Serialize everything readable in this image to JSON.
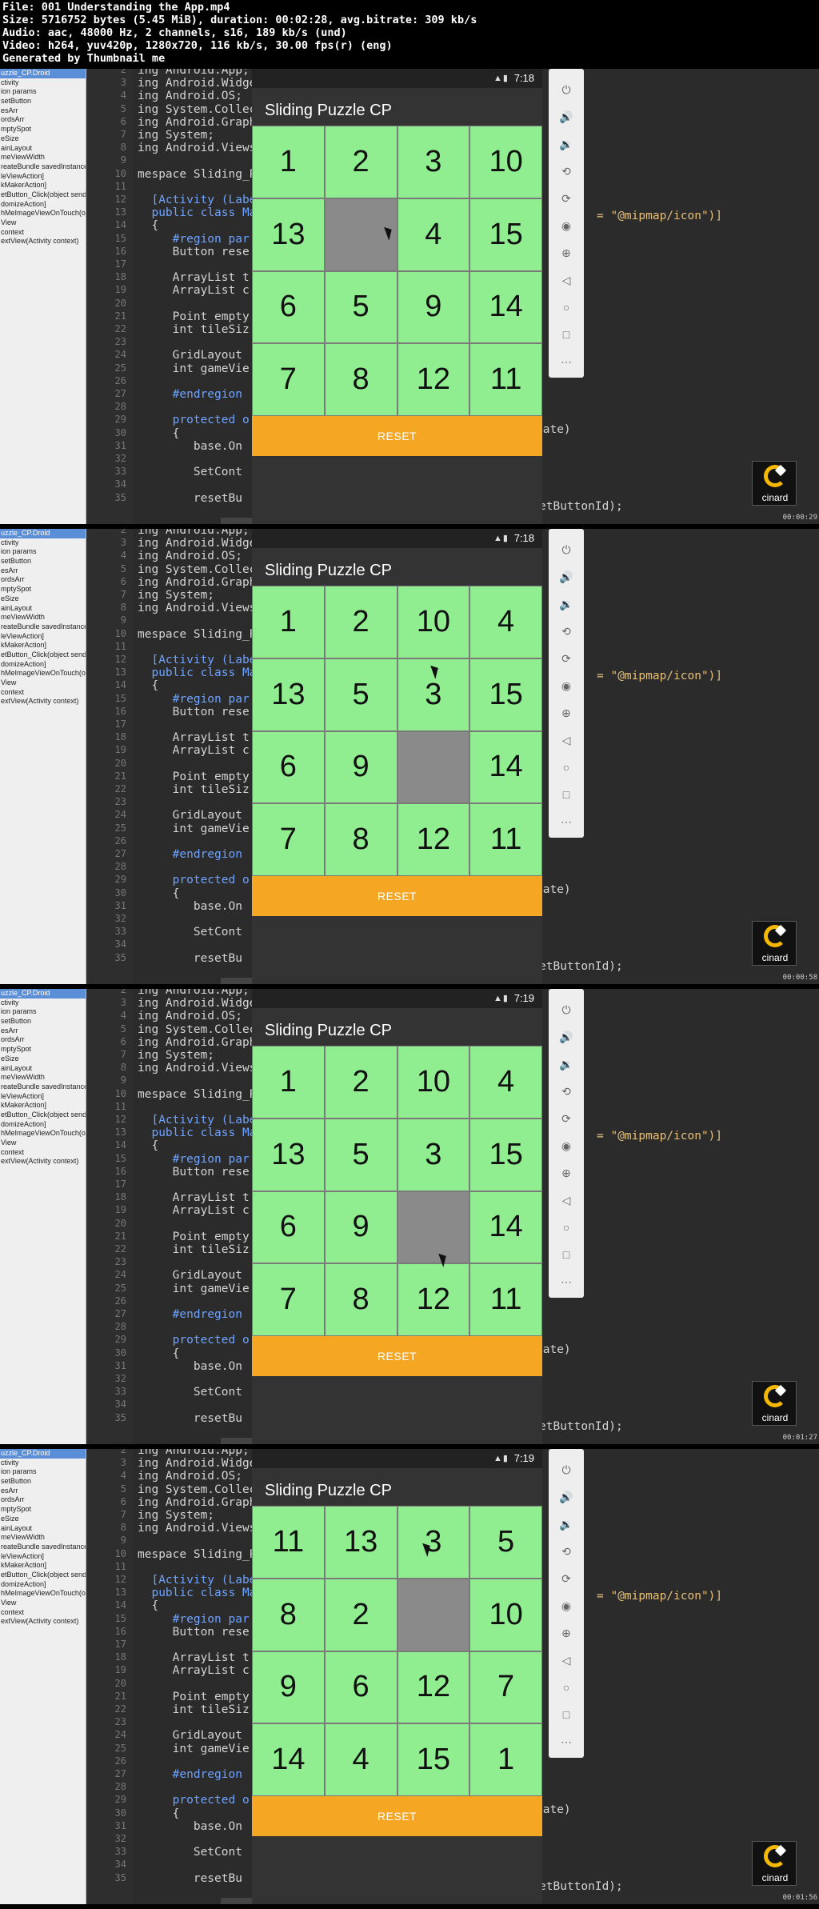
{
  "header": {
    "lines": [
      "File: 001 Understanding the App.mp4",
      "Size: 5716752 bytes (5.45 MiB), duration: 00:02:28, avg.bitrate: 309 kb/s",
      "Audio: aac, 48000 Hz, 2 channels, s16, 189 kb/s (und)",
      "Video: h264, yuv420p, 1280x720, 116 kb/s, 30.00 fps(r) (eng)",
      "Generated by Thumbnail me"
    ]
  },
  "sidebar_items": [
    "uzzle_CP.Droid",
    "ctivity",
    "ion params",
    "setButton",
    "esArr",
    "ordsArr",
    "mptySpot",
    "eSize",
    "ainLayout",
    "meViewWidth",
    "reateBundle savedInstance",
    "leViewAction]",
    "kMakerAction]",
    "etButton_Click(object sender",
    "domizeAction]",
    "hMeImageViewOnTouch(ob",
    "View",
    "context",
    "extView(Activity context)"
  ],
  "code_lines": [
    {
      "n": "2",
      "t": "ing Android.App;"
    },
    {
      "n": "3",
      "t": "ing Android.Widge"
    },
    {
      "n": "4",
      "t": "ing Android.OS;"
    },
    {
      "n": "5",
      "t": "ing System.Collec"
    },
    {
      "n": "6",
      "t": "ing Android.Graph"
    },
    {
      "n": "7",
      "t": "ing System;"
    },
    {
      "n": "8",
      "t": "ing Android.Views"
    },
    {
      "n": "9",
      "t": ""
    },
    {
      "n": "10",
      "t": "mespace Sliding_P"
    },
    {
      "n": "11",
      "t": ""
    },
    {
      "n": "12",
      "t": "  [Activity (Labe"
    },
    {
      "n": "13",
      "t": "  public class Ma"
    },
    {
      "n": "14",
      "t": "  {"
    },
    {
      "n": "15",
      "t": "     #region par"
    },
    {
      "n": "16",
      "t": "     Button rese"
    },
    {
      "n": "17",
      "t": ""
    },
    {
      "n": "18",
      "t": "     ArrayList t"
    },
    {
      "n": "19",
      "t": "     ArrayList c"
    },
    {
      "n": "20",
      "t": ""
    },
    {
      "n": "21",
      "t": "     Point empty"
    },
    {
      "n": "22",
      "t": "     int tileSiz"
    },
    {
      "n": "23",
      "t": ""
    },
    {
      "n": "24",
      "t": "     GridLayout"
    },
    {
      "n": "25",
      "t": "     int gameVie"
    },
    {
      "n": "26",
      "t": ""
    },
    {
      "n": "27",
      "t": "     #endregion"
    },
    {
      "n": "28",
      "t": ""
    },
    {
      "n": "29",
      "t": "     protected o"
    },
    {
      "n": "30",
      "t": "     {"
    },
    {
      "n": "31",
      "t": "        base.On"
    },
    {
      "n": "32",
      "t": ""
    },
    {
      "n": "33",
      "t": "        SetCont"
    },
    {
      "n": "34",
      "t": ""
    },
    {
      "n": "35",
      "t": "        resetBu"
    }
  ],
  "code_right": {
    "icon": "= \"@mipmap/icon\")]",
    "state": "tate)",
    "reset": "etButtonId);"
  },
  "app": {
    "title": "Sliding Puzzle CP",
    "reset_label": "RESET"
  },
  "logo_text": "cinard",
  "frames": [
    {
      "time": "7:18",
      "timestamp": "00:00:29",
      "tiles": [
        "1",
        "2",
        "3",
        "10",
        "13",
        "",
        "4",
        "15",
        "6",
        "5",
        "9",
        "14",
        "7",
        "8",
        "12",
        "11"
      ]
    },
    {
      "time": "7:18",
      "timestamp": "00:00:58",
      "tiles": [
        "1",
        "2",
        "10",
        "4",
        "13",
        "5",
        "3",
        "15",
        "6",
        "9",
        "",
        "14",
        "7",
        "8",
        "12",
        "11"
      ]
    },
    {
      "time": "7:19",
      "timestamp": "00:01:27",
      "tiles": [
        "1",
        "2",
        "10",
        "4",
        "13",
        "5",
        "3",
        "15",
        "6",
        "9",
        "",
        "14",
        "7",
        "8",
        "12",
        "11"
      ]
    },
    {
      "time": "7:19",
      "timestamp": "00:01:56",
      "tiles": [
        "11",
        "13",
        "3",
        "5",
        "8",
        "2",
        "",
        "10",
        "9",
        "6",
        "12",
        "7",
        "14",
        "4",
        "15",
        "1"
      ]
    }
  ]
}
